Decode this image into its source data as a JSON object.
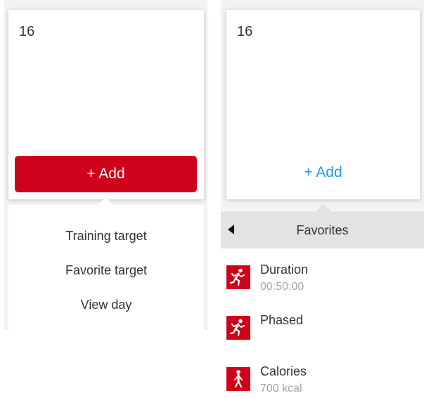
{
  "left_panel": {
    "day_number": "16",
    "add_button_label": "+ Add",
    "menu_items": [
      {
        "label": "Training target"
      },
      {
        "label": "Favorite target"
      },
      {
        "label": "View day"
      }
    ]
  },
  "right_panel": {
    "day_number": "16",
    "add_link_label": "+ Add",
    "favorites": {
      "title": "Favorites",
      "items": [
        {
          "name": "Duration",
          "detail": "00:50:00",
          "icon": "running-icon"
        },
        {
          "name": "Phased",
          "detail": "",
          "icon": "running-icon"
        },
        {
          "name": "Calories",
          "detail": "700 kcal",
          "icon": "walking-icon"
        }
      ]
    }
  },
  "colors": {
    "accent_red": "#d0021b",
    "link_blue": "#1e9fdc",
    "header_gray": "#e3e3e3",
    "muted_text": "#a5a5a5"
  }
}
